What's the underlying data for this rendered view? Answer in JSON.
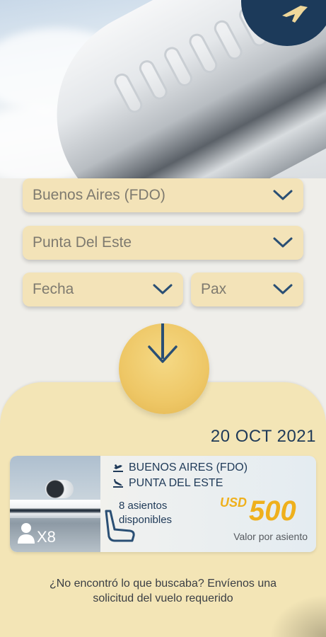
{
  "search": {
    "origin": "Buenos Aires (FDO)",
    "destination": "Punta Del Este",
    "date_placeholder": "Fecha",
    "pax_placeholder": "Pax"
  },
  "result": {
    "date": "20 OCT 2021",
    "origin": "BUENOS AIRES (FDO)",
    "destination": "PUNTA DEL ESTE",
    "capacity": "X8",
    "seats_line1": "8 asientos",
    "seats_line2": "disponibles",
    "currency": "USD",
    "price": "500",
    "price_note": "Valor por asiento"
  },
  "help": {
    "line1": "¿No encontró lo que buscaba? Envíenos una",
    "line2": "solicitud del vuelo requerido"
  },
  "colors": {
    "navy": "#1f3a58",
    "field": "#f3e3b8",
    "gold": "#efb01c",
    "panel": "#f3e5b6"
  },
  "icons": [
    "plane-badge-icon",
    "chevron-down-icon",
    "arrow-down-icon",
    "departure-icon",
    "arrival-icon",
    "person-icon",
    "seat-icon"
  ]
}
